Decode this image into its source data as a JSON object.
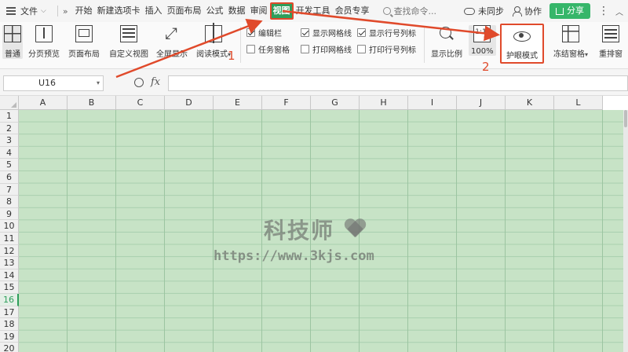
{
  "menubar": {
    "file_label": "文件",
    "tabs": [
      "开始",
      "新建选项卡",
      "插入",
      "页面布局",
      "公式",
      "数据",
      "审阅",
      "视图",
      "开发工具",
      "会员专享"
    ],
    "active_tab": "视图",
    "search_placeholder": "查找命令...",
    "sync_label": "未同步",
    "collab_label": "协作",
    "share_label": "分享"
  },
  "ribbon": {
    "buttons": {
      "normal": "普通",
      "page_break": "分页预览",
      "page_layout": "页面布局",
      "custom_view": "自定义视图",
      "full_screen": "全屏显示",
      "reading_mode": "阅读模式",
      "zoom": "显示比例",
      "zoom_100": "100%",
      "eye_care": "护眼模式",
      "freeze": "冻结窗格",
      "arrange": "重排窗"
    },
    "checks": [
      {
        "label": "编辑栏",
        "checked": true
      },
      {
        "label": "任务窗格",
        "checked": false
      },
      {
        "label": "显示网格线",
        "checked": true
      },
      {
        "label": "打印网格线",
        "checked": false
      },
      {
        "label": "显示行号列标",
        "checked": true
      },
      {
        "label": "打印行号列标",
        "checked": false
      }
    ]
  },
  "formula_bar": {
    "name_box": "U16",
    "fx": "fx",
    "value": ""
  },
  "sheet": {
    "columns": [
      "A",
      "B",
      "C",
      "D",
      "E",
      "F",
      "G",
      "H",
      "I",
      "J",
      "K",
      "L"
    ],
    "rows": [
      "1",
      "2",
      "3",
      "4",
      "5",
      "6",
      "7",
      "8",
      "9",
      "10",
      "11",
      "12",
      "13",
      "14",
      "15",
      "16",
      "17",
      "18",
      "19",
      "20"
    ],
    "selected_row": "16",
    "cell_color": "#c7e3c6"
  },
  "watermark": {
    "brand": "科技师",
    "url": "https://www.3kjs.com"
  },
  "annotations": {
    "step1": "1",
    "step2": "2",
    "color": "#e04a2b"
  }
}
